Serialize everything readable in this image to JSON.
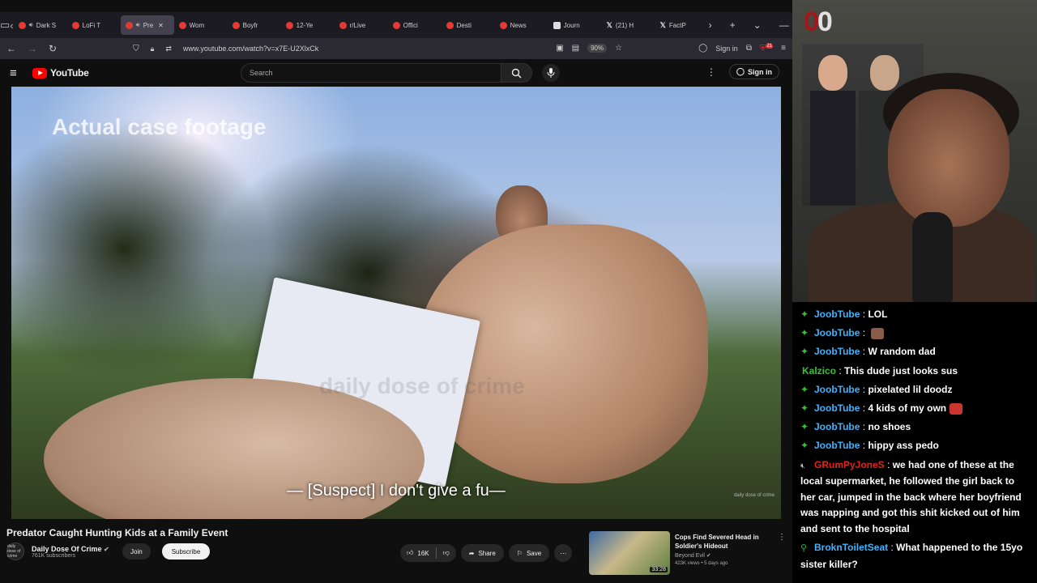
{
  "browser": {
    "tabs": [
      {
        "label": "Dark S",
        "active": false,
        "icon": "youtube-icon",
        "speaker": true
      },
      {
        "label": "LoFi T",
        "active": false,
        "icon": "youtube-icon",
        "speaker": false
      },
      {
        "label": "Pre",
        "active": true,
        "icon": "youtube-icon",
        "speaker": true
      },
      {
        "label": "Wom",
        "active": false,
        "icon": "youtube-icon",
        "speaker": false
      },
      {
        "label": "Boyfr",
        "active": false,
        "icon": "youtube-icon",
        "speaker": false
      },
      {
        "label": "12-Ye",
        "active": false,
        "icon": "youtube-icon",
        "speaker": false
      },
      {
        "label": "r/Live",
        "active": false,
        "icon": "reddit-icon",
        "speaker": false
      },
      {
        "label": "Offici",
        "active": false,
        "icon": "reddit-icon",
        "speaker": false
      },
      {
        "label": "Desti",
        "active": false,
        "icon": "reddit-icon",
        "speaker": false
      },
      {
        "label": "News",
        "active": false,
        "icon": "reddit-icon",
        "speaker": false
      },
      {
        "label": "Journ",
        "active": false,
        "icon": "news-icon",
        "speaker": false
      },
      {
        "label": "(21) H",
        "active": false,
        "icon": "x-icon",
        "speaker": false
      },
      {
        "label": "FactP",
        "active": false,
        "icon": "x-icon",
        "speaker": false
      }
    ],
    "url": "www.youtube.com/watch?v=x7E-U2XlxCk",
    "zoom": "90%",
    "signin_label": "Sign in",
    "badge_count": "21"
  },
  "youtube": {
    "logo_text": "YouTube",
    "search_placeholder": "Search",
    "signin_label": "Sign in"
  },
  "video": {
    "overlay_text": "Actual case footage",
    "subtitle": "— [Suspect] I don't give a fu—",
    "watermark_corner": "daily dose of crime",
    "watermark_mid": "daily dose of crime"
  },
  "meta": {
    "title": "Predator Caught Hunting Kids at a Family Event",
    "channel_name": "Daily Dose Of Crime",
    "channel_avatar_text": "daily dose of crime",
    "subscribers": "761K subscribers",
    "join_label": "Join",
    "subscribe_label": "Subscribe",
    "likes": "16K",
    "share_label": "Share",
    "save_label": "Save"
  },
  "recommended": {
    "title": "Cops Find Severed Head in Soldier's Hideout",
    "channel": "Beyond Evil",
    "views": "423K views",
    "age": "5 days ago",
    "duration": "33:28"
  },
  "stream": {
    "score_digit_red": "0",
    "score_digit": "0"
  },
  "chat": [
    {
      "user": "JoobTube",
      "color": "#3fb3ff",
      "badge": "sub-icon",
      "text": "LOL",
      "emote": ""
    },
    {
      "user": "JoobTube",
      "color": "#3fb3ff",
      "badge": "sub-icon",
      "text": "",
      "emote": "face-emote"
    },
    {
      "user": "JoobTube",
      "color": "#3fb3ff",
      "badge": "sub-icon",
      "text": "W random dad",
      "emote": ""
    },
    {
      "user": "Kalzico",
      "color": "#3cc13c",
      "badge": "",
      "text": "This dude just looks sus",
      "emote": ""
    },
    {
      "user": "JoobTube",
      "color": "#3fb3ff",
      "badge": "sub-icon",
      "text": "pixelated lil doodz",
      "emote": ""
    },
    {
      "user": "JoobTube",
      "color": "#3fb3ff",
      "badge": "sub-icon",
      "text": "4 kids of my own",
      "emote": "red-emote"
    },
    {
      "user": "JoobTube",
      "color": "#3fb3ff",
      "badge": "sub-icon",
      "text": "no shoes",
      "emote": ""
    },
    {
      "user": "JoobTube",
      "color": "#3fb3ff",
      "badge": "sub-icon",
      "text": "hippy ass pedo",
      "emote": ""
    },
    {
      "user": "GRumPyJoneS",
      "color": "#e0231b",
      "badge": "mute-icon",
      "text": "we had one of these at the local supermarket, he followed the girl back to her car, jumped in the back where her boyfriend was napping and got this shit kicked out of him and sent to the hospital",
      "emote": ""
    },
    {
      "user": "BroknToiletSeat",
      "color": "#3fb3ff",
      "badge": "user-icon",
      "text": "What happened to the 15yo sister killer?",
      "emote": ""
    }
  ]
}
